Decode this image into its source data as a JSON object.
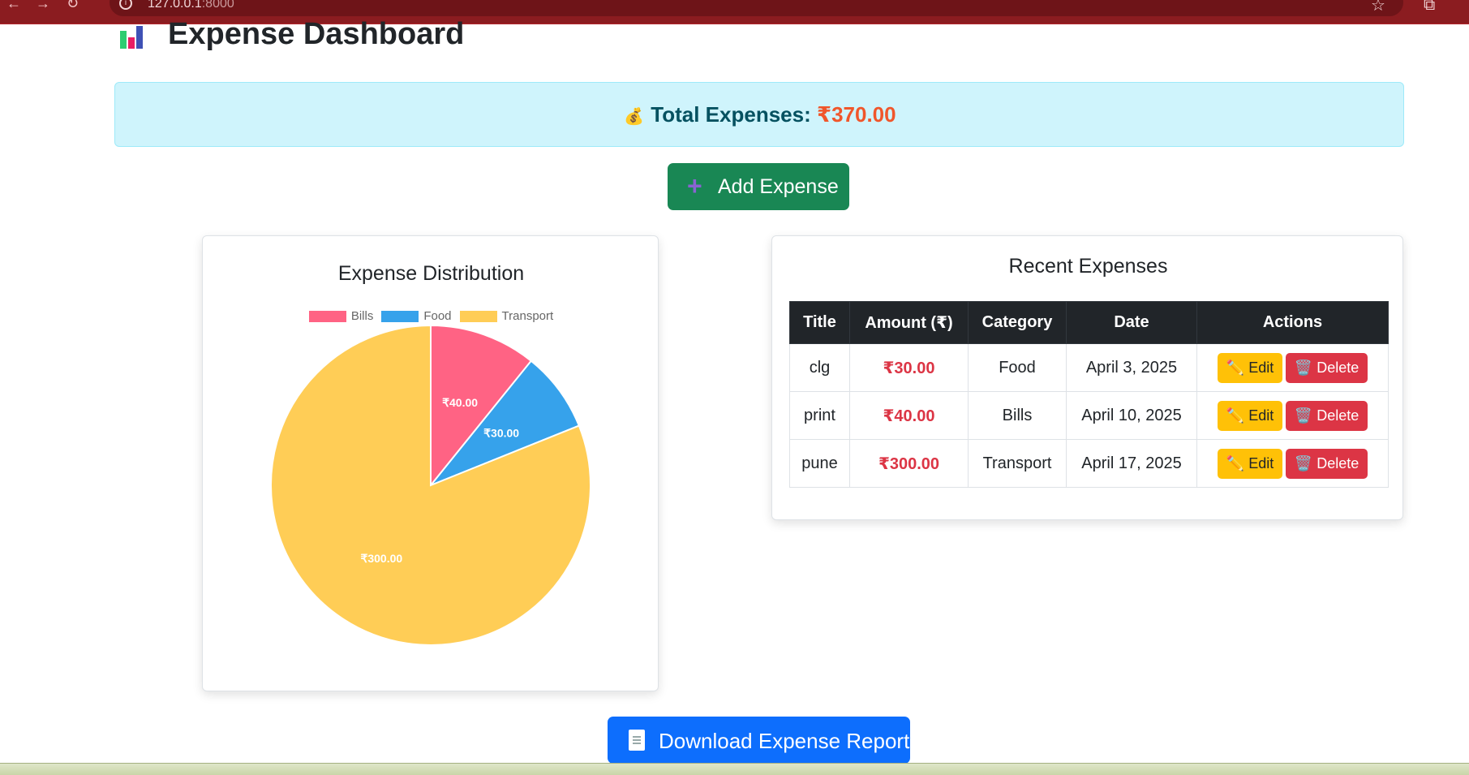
{
  "browser": {
    "url_host": "127.0.0.1",
    "url_port": ":8000"
  },
  "header": {
    "title": "Expense Dashboard",
    "icon": "bar-chart-icon"
  },
  "summary": {
    "label": "Total Expenses:",
    "amount": "₹370.00",
    "icon": "money-bag-icon"
  },
  "actions": {
    "add_label": "Add Expense",
    "download_label": "Download Expense Report"
  },
  "chart_card": {
    "title": "Expense Distribution"
  },
  "chart_data": {
    "type": "pie",
    "title": "Expense Distribution",
    "legend_position": "top",
    "categories": [
      "Bills",
      "Food",
      "Transport"
    ],
    "values": [
      40,
      30,
      300
    ],
    "labels": [
      "₹40.00",
      "₹30.00",
      "₹300.00"
    ],
    "colors": [
      "#ff6384",
      "#36a2eb",
      "#ffcd56"
    ]
  },
  "table": {
    "title": "Recent Expenses",
    "columns": [
      "Title",
      "Amount (₹)",
      "Category",
      "Date",
      "Actions"
    ],
    "rows": [
      {
        "title": "clg",
        "amount": "₹30.00",
        "category": "Food",
        "date": "April 3, 2025"
      },
      {
        "title": "print",
        "amount": "₹40.00",
        "category": "Bills",
        "date": "April 10, 2025"
      },
      {
        "title": "pune",
        "amount": "₹300.00",
        "category": "Transport",
        "date": "April 17, 2025"
      }
    ],
    "edit_label": "Edit",
    "delete_label": "Delete"
  },
  "colors": {
    "success": "#198754",
    "primary": "#0d6efd",
    "warning": "#ffc107",
    "danger": "#dc3545",
    "info_bg": "#cff4fc"
  }
}
